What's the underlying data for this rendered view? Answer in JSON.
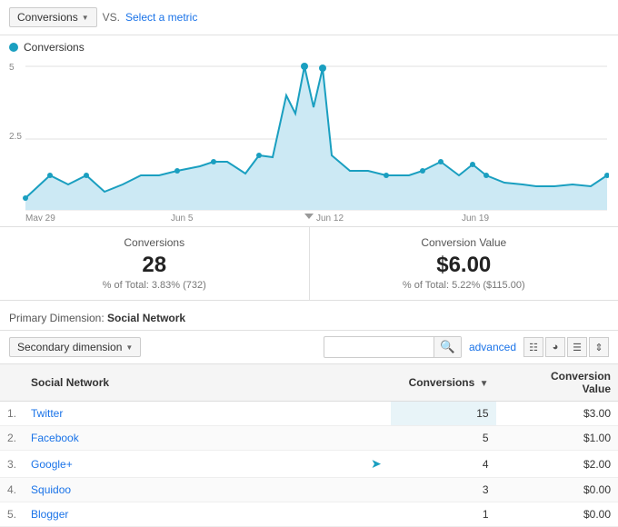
{
  "header": {
    "metric_label": "Conversions",
    "vs_label": "VS.",
    "select_metric_label": "Select a metric"
  },
  "legend": {
    "label": "Conversions"
  },
  "stats": {
    "conversions": {
      "title": "Conversions",
      "value": "28",
      "subtitle": "% of Total: 3.83% (732)"
    },
    "conversion_value": {
      "title": "Conversion Value",
      "value": "$6.00",
      "subtitle": "% of Total: 5.22% ($115.00)"
    }
  },
  "primary_dimension": {
    "prefix": "Primary Dimension:",
    "value": "Social Network"
  },
  "toolbar": {
    "secondary_dim_label": "Secondary dimension",
    "search_placeholder": "",
    "advanced_label": "advanced"
  },
  "table": {
    "headers": [
      {
        "label": "",
        "key": "index"
      },
      {
        "label": "Social Network",
        "key": "network"
      },
      {
        "label": "",
        "key": "actions"
      },
      {
        "label": "Conversions",
        "key": "conversions",
        "sortable": true
      },
      {
        "label": "",
        "key": "sort_arrow"
      },
      {
        "label": "Conversion Value",
        "key": "value"
      }
    ],
    "rows": [
      {
        "index": "1.",
        "network": "Twitter",
        "conversions": "15",
        "value": "$3.00",
        "has_icon": false
      },
      {
        "index": "2.",
        "network": "Facebook",
        "conversions": "5",
        "value": "$1.00",
        "has_icon": false
      },
      {
        "index": "3.",
        "network": "Google+",
        "conversions": "4",
        "value": "$2.00",
        "has_icon": true
      },
      {
        "index": "4.",
        "network": "Squidoo",
        "conversions": "3",
        "value": "$0.00",
        "has_icon": false
      },
      {
        "index": "5.",
        "network": "Blogger",
        "conversions": "1",
        "value": "$0.00",
        "has_icon": false
      }
    ]
  },
  "chart": {
    "y_labels": [
      "5",
      "2.5",
      ""
    ],
    "x_labels": [
      "May 29",
      "Jun 5",
      "Jun 12",
      "Jun 19"
    ],
    "color": "#1a9fc0"
  }
}
